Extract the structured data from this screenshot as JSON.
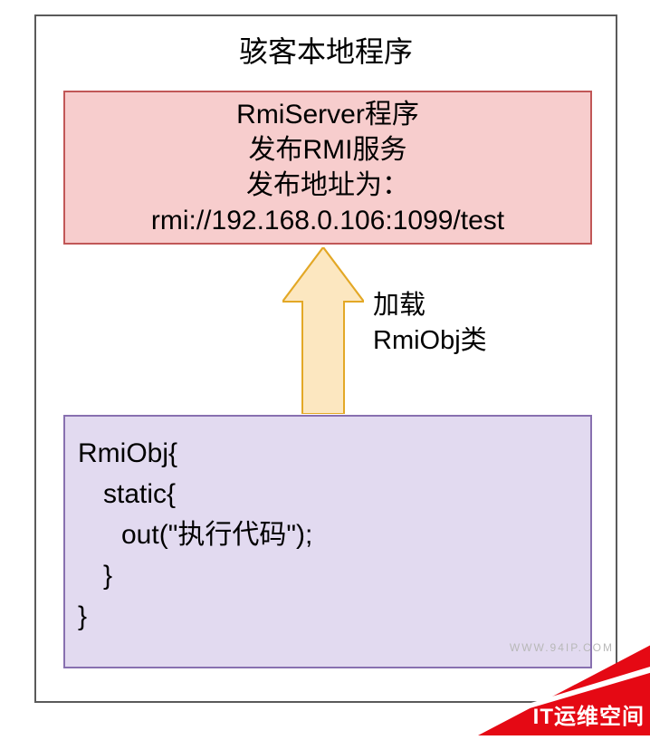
{
  "outer": {
    "title": "骇客本地程序"
  },
  "server": {
    "line1": "RmiServer程序",
    "line2": "发布RMI服务",
    "line3": "发布地址为：",
    "line4": "rmi://192.168.0.106:1099/test"
  },
  "arrow": {
    "label_line1": "加载",
    "label_line2": "RmiObj类",
    "colors": {
      "fill": "#fce7c0",
      "stroke": "#e3a826"
    }
  },
  "obj": {
    "l1": "RmiObj{",
    "l2": "static{",
    "l3": "out(\"执行代码\");",
    "l4": "}",
    "l5": "}"
  },
  "watermark": "WWW.94IP.COM",
  "banner": {
    "text": "IT运维空间",
    "color": "#e50914"
  }
}
